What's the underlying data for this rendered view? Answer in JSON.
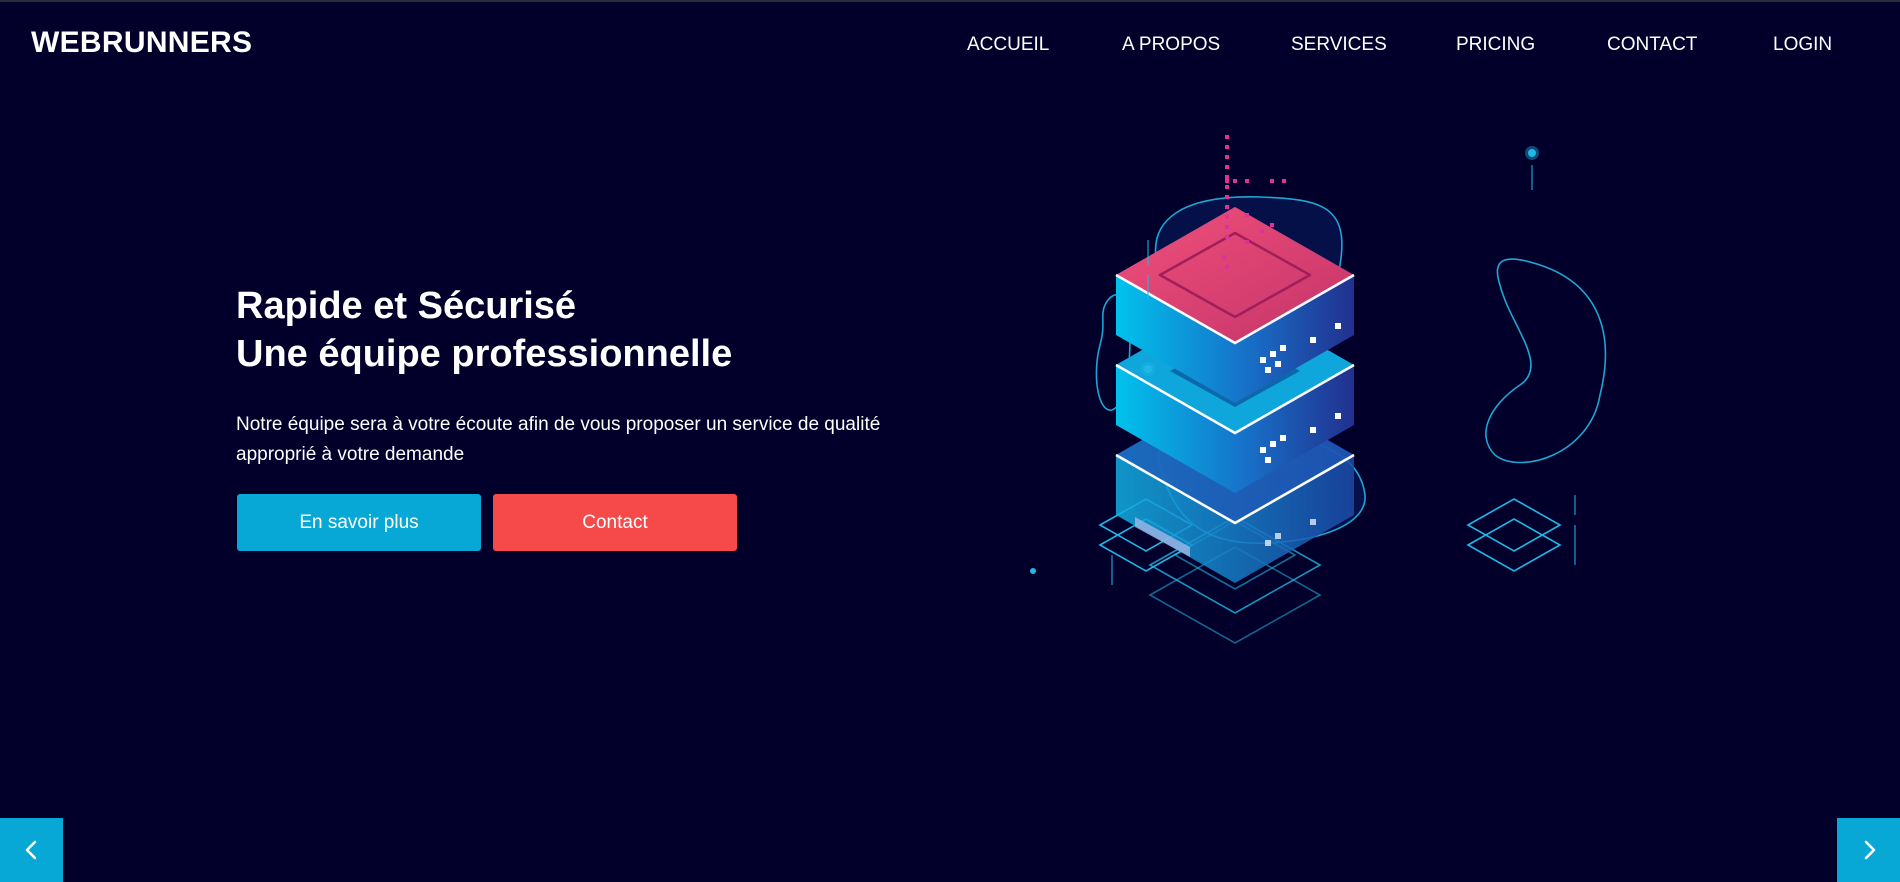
{
  "brand": {
    "name": "WEBRUNNERS"
  },
  "nav": {
    "items": [
      {
        "label": "ACCUEIL"
      },
      {
        "label": "A PROPOS"
      },
      {
        "label": "SERVICES"
      },
      {
        "label": "PRICING"
      },
      {
        "label": "CONTACT"
      },
      {
        "label": "LOGIN"
      }
    ]
  },
  "hero": {
    "title_line1": "Rapide et Sécurisé",
    "title_line2": "Une équipe professionnelle",
    "text_line1": "Notre équipe sera à votre écoute afin de vous proposer un service de qualité",
    "text_line2": "approprié à votre demande",
    "primary_button": "En savoir plus",
    "secondary_button": "Contact"
  },
  "illustration": {
    "icon": "server-stack-icon"
  },
  "carousel": {
    "prev_icon": "chevron-left-icon",
    "next_icon": "chevron-right-icon"
  },
  "colors": {
    "background": "#02002b",
    "accent_blue": "#08a8d6",
    "accent_red": "#f64949",
    "server_pink": "#e0456e",
    "server_cyan": "#00b4e6",
    "line_cyan": "#1fb8e6"
  }
}
